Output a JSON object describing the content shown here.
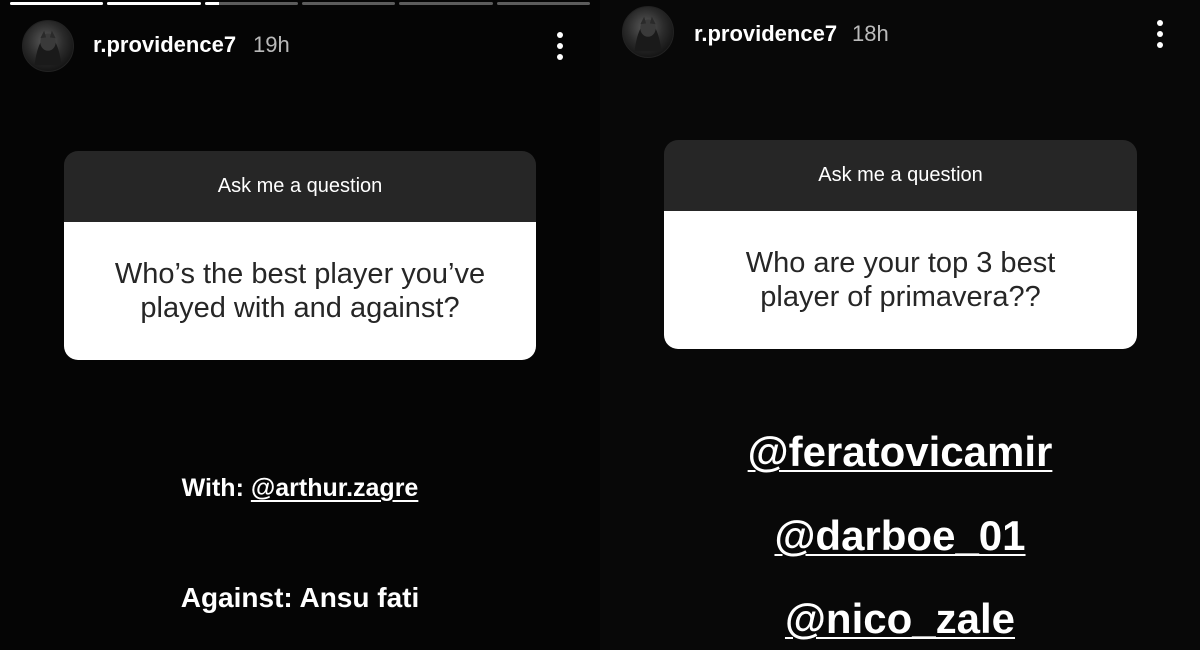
{
  "left_story": {
    "progress": [
      1,
      1,
      0.15,
      0,
      0,
      0
    ],
    "username": "r.providence7",
    "time": "19h",
    "icons": {
      "avatar": "profile-avatar",
      "more": "more-vertical-icon"
    },
    "sticker": {
      "header": "Ask me a question",
      "question": "Who’s the best player you’ve played with and against?"
    },
    "answer_with_prefix": "With: ",
    "answer_with_mention": "@arthur.zagre",
    "answer_against": "Against: Ansu fati"
  },
  "right_story": {
    "username": "r.providence7",
    "time": "18h",
    "icons": {
      "avatar": "profile-avatar",
      "more": "more-vertical-icon"
    },
    "sticker": {
      "header": "Ask me a question",
      "question": "Who are your top 3 best player of primavera??"
    },
    "mentions": [
      "@feratovicamir",
      "@darboe_01",
      "@nico_zale"
    ]
  }
}
